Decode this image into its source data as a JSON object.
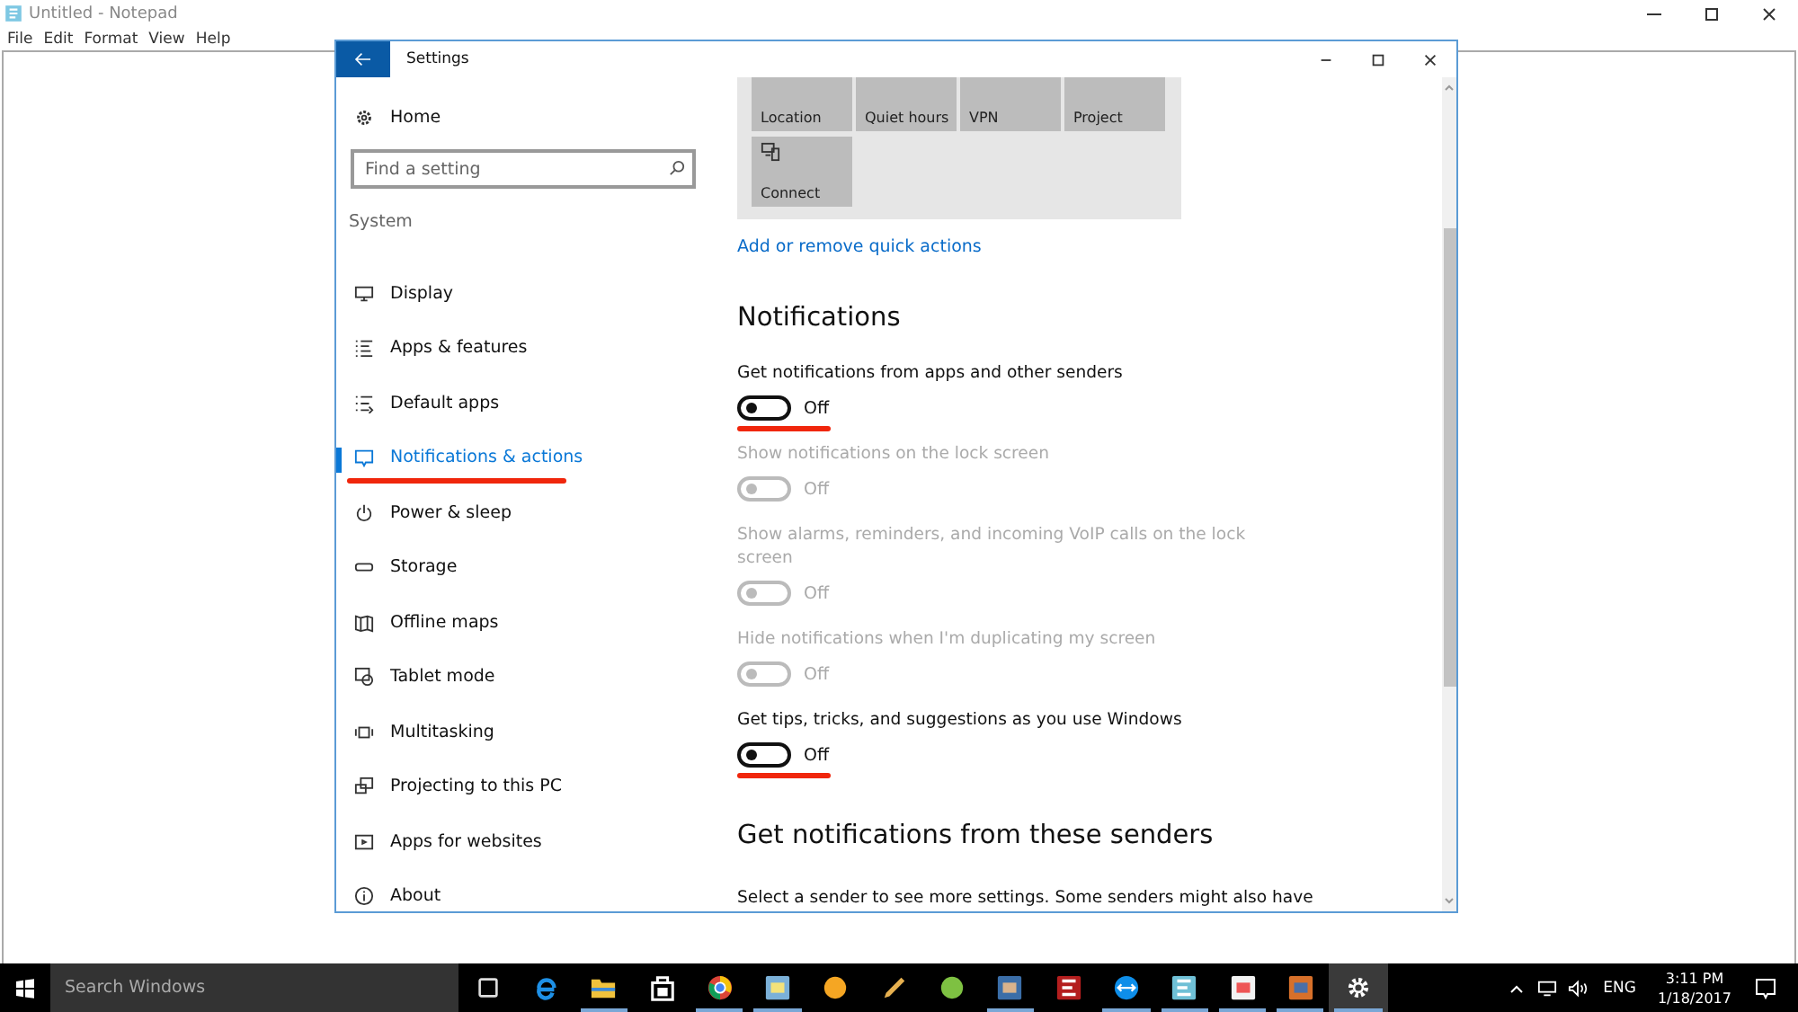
{
  "notepad": {
    "title": "Untitled - Notepad",
    "menu": [
      "File",
      "Edit",
      "Format",
      "View",
      "Help"
    ]
  },
  "settings": {
    "title": "Settings",
    "nav": {
      "home": "Home",
      "search_placeholder": "Find a setting",
      "section": "System",
      "items": [
        {
          "label": "Display",
          "kind": "display",
          "selected": false,
          "highlighted": false
        },
        {
          "label": "Apps & features",
          "kind": "list",
          "selected": false,
          "highlighted": false
        },
        {
          "label": "Default apps",
          "kind": "list-arrow",
          "selected": false,
          "highlighted": false
        },
        {
          "label": "Notifications & actions",
          "kind": "message",
          "selected": true,
          "highlighted": true
        },
        {
          "label": "Power & sleep",
          "kind": "power",
          "selected": false,
          "highlighted": false
        },
        {
          "label": "Storage",
          "kind": "drive",
          "selected": false,
          "highlighted": false
        },
        {
          "label": "Offline maps",
          "kind": "map",
          "selected": false,
          "highlighted": false
        },
        {
          "label": "Tablet mode",
          "kind": "tablet",
          "selected": false,
          "highlighted": false
        },
        {
          "label": "Multitasking",
          "kind": "multitask",
          "selected": false,
          "highlighted": false
        },
        {
          "label": "Projecting to this PC",
          "kind": "project",
          "selected": false,
          "highlighted": false
        },
        {
          "label": "Apps for websites",
          "kind": "web",
          "selected": false,
          "highlighted": false
        },
        {
          "label": "About",
          "kind": "info",
          "selected": false,
          "highlighted": false
        }
      ]
    },
    "quick_actions": [
      {
        "label": "Location"
      },
      {
        "label": "Quiet hours"
      },
      {
        "label": "VPN"
      },
      {
        "label": "Project"
      },
      {
        "label": "Connect",
        "kind": "connect"
      }
    ],
    "quick_actions_link": "Add or remove quick actions",
    "notifications_heading": "Notifications",
    "toggles": [
      {
        "label": "Get notifications from apps and other senders",
        "on": false,
        "disabled": false,
        "state_text": "Off",
        "highlighted": true
      },
      {
        "label": "Show notifications on the lock screen",
        "on": false,
        "disabled": true,
        "state_text": "Off",
        "highlighted": false
      },
      {
        "label": "Show alarms, reminders, and incoming VoIP calls on the lock screen",
        "on": false,
        "disabled": true,
        "state_text": "Off",
        "highlighted": false
      },
      {
        "label": "Hide notifications when I'm duplicating my screen",
        "on": false,
        "disabled": true,
        "state_text": "Off",
        "highlighted": false
      },
      {
        "label": "Get tips, tricks, and suggestions as you use Windows",
        "on": false,
        "disabled": false,
        "state_text": "Off",
        "highlighted": true
      }
    ],
    "senders_heading": "Get notifications from these senders",
    "senders_text": "Select a sender to see more settings. Some senders might also have"
  },
  "taskbar": {
    "search_placeholder": "Search Windows",
    "apps": [
      {
        "kind": "task-view",
        "running": false,
        "selected": false
      },
      {
        "kind": "edge",
        "running": false,
        "selected": false
      },
      {
        "kind": "folder",
        "running": true,
        "selected": false
      },
      {
        "kind": "store",
        "running": false,
        "selected": false
      },
      {
        "kind": "chrome",
        "running": true,
        "selected": false
      },
      {
        "kind": "mail",
        "running": true,
        "selected": false
      },
      {
        "kind": "orange",
        "running": false,
        "selected": false
      },
      {
        "kind": "pen",
        "running": false,
        "selected": false
      },
      {
        "kind": "green",
        "running": false,
        "selected": false
      },
      {
        "kind": "photo",
        "running": true,
        "selected": false
      },
      {
        "kind": "ftp",
        "running": false,
        "selected": false
      },
      {
        "kind": "remote",
        "running": true,
        "selected": false
      },
      {
        "kind": "notepad",
        "running": true,
        "selected": false
      },
      {
        "kind": "paint",
        "running": true,
        "selected": false
      },
      {
        "kind": "media",
        "running": true,
        "selected": false
      },
      {
        "kind": "gear",
        "running": true,
        "selected": true
      }
    ],
    "language": "ENG",
    "time": "3:11 PM",
    "date": "1/18/2017"
  }
}
